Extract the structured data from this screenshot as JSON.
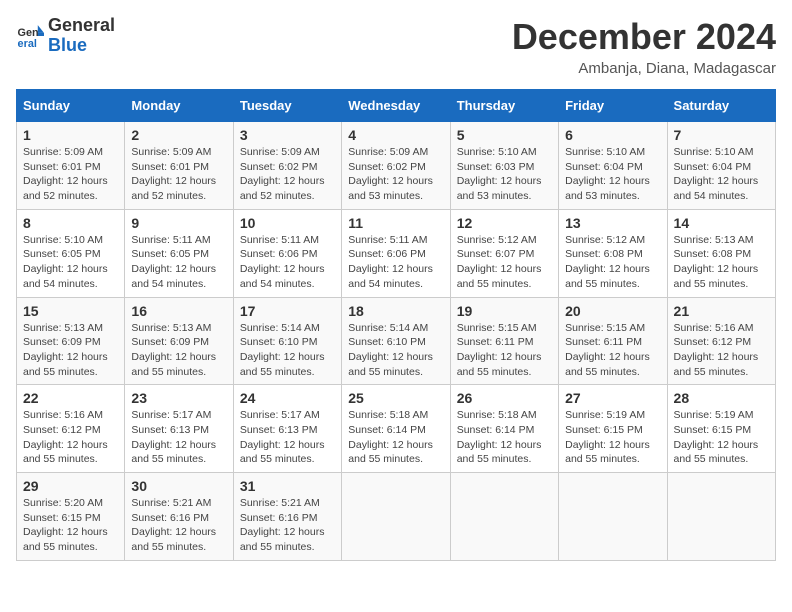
{
  "header": {
    "logo_line1": "General",
    "logo_line2": "Blue",
    "title": "December 2024",
    "subtitle": "Ambanja, Diana, Madagascar"
  },
  "calendar": {
    "days_of_week": [
      "Sunday",
      "Monday",
      "Tuesday",
      "Wednesday",
      "Thursday",
      "Friday",
      "Saturday"
    ],
    "weeks": [
      [
        {
          "day": "1",
          "info": "Sunrise: 5:09 AM\nSunset: 6:01 PM\nDaylight: 12 hours\nand 52 minutes."
        },
        {
          "day": "2",
          "info": "Sunrise: 5:09 AM\nSunset: 6:01 PM\nDaylight: 12 hours\nand 52 minutes."
        },
        {
          "day": "3",
          "info": "Sunrise: 5:09 AM\nSunset: 6:02 PM\nDaylight: 12 hours\nand 52 minutes."
        },
        {
          "day": "4",
          "info": "Sunrise: 5:09 AM\nSunset: 6:02 PM\nDaylight: 12 hours\nand 53 minutes."
        },
        {
          "day": "5",
          "info": "Sunrise: 5:10 AM\nSunset: 6:03 PM\nDaylight: 12 hours\nand 53 minutes."
        },
        {
          "day": "6",
          "info": "Sunrise: 5:10 AM\nSunset: 6:04 PM\nDaylight: 12 hours\nand 53 minutes."
        },
        {
          "day": "7",
          "info": "Sunrise: 5:10 AM\nSunset: 6:04 PM\nDaylight: 12 hours\nand 54 minutes."
        }
      ],
      [
        {
          "day": "8",
          "info": "Sunrise: 5:10 AM\nSunset: 6:05 PM\nDaylight: 12 hours\nand 54 minutes."
        },
        {
          "day": "9",
          "info": "Sunrise: 5:11 AM\nSunset: 6:05 PM\nDaylight: 12 hours\nand 54 minutes."
        },
        {
          "day": "10",
          "info": "Sunrise: 5:11 AM\nSunset: 6:06 PM\nDaylight: 12 hours\nand 54 minutes."
        },
        {
          "day": "11",
          "info": "Sunrise: 5:11 AM\nSunset: 6:06 PM\nDaylight: 12 hours\nand 54 minutes."
        },
        {
          "day": "12",
          "info": "Sunrise: 5:12 AM\nSunset: 6:07 PM\nDaylight: 12 hours\nand 55 minutes."
        },
        {
          "day": "13",
          "info": "Sunrise: 5:12 AM\nSunset: 6:08 PM\nDaylight: 12 hours\nand 55 minutes."
        },
        {
          "day": "14",
          "info": "Sunrise: 5:13 AM\nSunset: 6:08 PM\nDaylight: 12 hours\nand 55 minutes."
        }
      ],
      [
        {
          "day": "15",
          "info": "Sunrise: 5:13 AM\nSunset: 6:09 PM\nDaylight: 12 hours\nand 55 minutes."
        },
        {
          "day": "16",
          "info": "Sunrise: 5:13 AM\nSunset: 6:09 PM\nDaylight: 12 hours\nand 55 minutes."
        },
        {
          "day": "17",
          "info": "Sunrise: 5:14 AM\nSunset: 6:10 PM\nDaylight: 12 hours\nand 55 minutes."
        },
        {
          "day": "18",
          "info": "Sunrise: 5:14 AM\nSunset: 6:10 PM\nDaylight: 12 hours\nand 55 minutes."
        },
        {
          "day": "19",
          "info": "Sunrise: 5:15 AM\nSunset: 6:11 PM\nDaylight: 12 hours\nand 55 minutes."
        },
        {
          "day": "20",
          "info": "Sunrise: 5:15 AM\nSunset: 6:11 PM\nDaylight: 12 hours\nand 55 minutes."
        },
        {
          "day": "21",
          "info": "Sunrise: 5:16 AM\nSunset: 6:12 PM\nDaylight: 12 hours\nand 55 minutes."
        }
      ],
      [
        {
          "day": "22",
          "info": "Sunrise: 5:16 AM\nSunset: 6:12 PM\nDaylight: 12 hours\nand 55 minutes."
        },
        {
          "day": "23",
          "info": "Sunrise: 5:17 AM\nSunset: 6:13 PM\nDaylight: 12 hours\nand 55 minutes."
        },
        {
          "day": "24",
          "info": "Sunrise: 5:17 AM\nSunset: 6:13 PM\nDaylight: 12 hours\nand 55 minutes."
        },
        {
          "day": "25",
          "info": "Sunrise: 5:18 AM\nSunset: 6:14 PM\nDaylight: 12 hours\nand 55 minutes."
        },
        {
          "day": "26",
          "info": "Sunrise: 5:18 AM\nSunset: 6:14 PM\nDaylight: 12 hours\nand 55 minutes."
        },
        {
          "day": "27",
          "info": "Sunrise: 5:19 AM\nSunset: 6:15 PM\nDaylight: 12 hours\nand 55 minutes."
        },
        {
          "day": "28",
          "info": "Sunrise: 5:19 AM\nSunset: 6:15 PM\nDaylight: 12 hours\nand 55 minutes."
        }
      ],
      [
        {
          "day": "29",
          "info": "Sunrise: 5:20 AM\nSunset: 6:15 PM\nDaylight: 12 hours\nand 55 minutes."
        },
        {
          "day": "30",
          "info": "Sunrise: 5:21 AM\nSunset: 6:16 PM\nDaylight: 12 hours\nand 55 minutes."
        },
        {
          "day": "31",
          "info": "Sunrise: 5:21 AM\nSunset: 6:16 PM\nDaylight: 12 hours\nand 55 minutes."
        },
        {
          "day": "",
          "info": ""
        },
        {
          "day": "",
          "info": ""
        },
        {
          "day": "",
          "info": ""
        },
        {
          "day": "",
          "info": ""
        }
      ]
    ]
  }
}
